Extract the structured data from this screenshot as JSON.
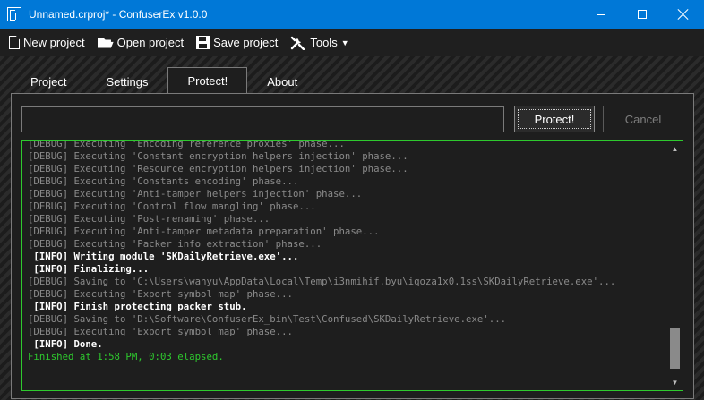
{
  "window": {
    "title": "Unnamed.crproj* - ConfuserEx v1.0.0"
  },
  "toolbar": {
    "new_label": "New project",
    "open_label": "Open project",
    "save_label": "Save project",
    "tools_label": "Tools"
  },
  "tabs": [
    {
      "label": "Project",
      "active": false
    },
    {
      "label": "Settings",
      "active": false
    },
    {
      "label": "Protect!",
      "active": true
    },
    {
      "label": "About",
      "active": false
    }
  ],
  "protect": {
    "target_value": "",
    "protect_label": "Protect!",
    "cancel_label": "Cancel"
  },
  "log": [
    {
      "level": "debug",
      "text": "[DEBUG] Executing 'Encoding reference proxies' phase..."
    },
    {
      "level": "debug",
      "text": "[DEBUG] Executing 'Constant encryption helpers injection' phase..."
    },
    {
      "level": "debug",
      "text": "[DEBUG] Executing 'Resource encryption helpers injection' phase..."
    },
    {
      "level": "debug",
      "text": "[DEBUG] Executing 'Constants encoding' phase..."
    },
    {
      "level": "debug",
      "text": "[DEBUG] Executing 'Anti-tamper helpers injection' phase..."
    },
    {
      "level": "debug",
      "text": "[DEBUG] Executing 'Control flow mangling' phase..."
    },
    {
      "level": "debug",
      "text": "[DEBUG] Executing 'Post-renaming' phase..."
    },
    {
      "level": "debug",
      "text": "[DEBUG] Executing 'Anti-tamper metadata preparation' phase..."
    },
    {
      "level": "debug",
      "text": "[DEBUG] Executing 'Packer info extraction' phase..."
    },
    {
      "level": "info",
      "text": " [INFO] Writing module 'SKDailyRetrieve.exe'..."
    },
    {
      "level": "info",
      "text": " [INFO] Finalizing..."
    },
    {
      "level": "debug",
      "text": "[DEBUG] Saving to 'C:\\Users\\wahyu\\AppData\\Local\\Temp\\i3nmihif.byu\\iqoza1x0.1ss\\SKDailyRetrieve.exe'..."
    },
    {
      "level": "debug",
      "text": "[DEBUG] Executing 'Export symbol map' phase..."
    },
    {
      "level": "info",
      "text": " [INFO] Finish protecting packer stub."
    },
    {
      "level": "debug",
      "text": "[DEBUG] Saving to 'D:\\Software\\ConfuserEx_bin\\Test\\Confused\\SKDailyRetrieve.exe'..."
    },
    {
      "level": "debug",
      "text": "[DEBUG] Executing 'Export symbol map' phase..."
    },
    {
      "level": "info",
      "text": " [INFO] Done."
    },
    {
      "level": "done",
      "text": "Finished at 1:58 PM, 0:03 elapsed."
    }
  ],
  "colors": {
    "titlebar": "#0078d7",
    "log_border": "#2ec92e",
    "debug_text": "#8a8a8a",
    "info_text": "#ffffff",
    "done_text": "#2ec92e"
  },
  "icons": {
    "new": "new-file-icon",
    "open": "folder-open-icon",
    "save": "floppy-disk-icon",
    "tools": "tools-icon"
  }
}
